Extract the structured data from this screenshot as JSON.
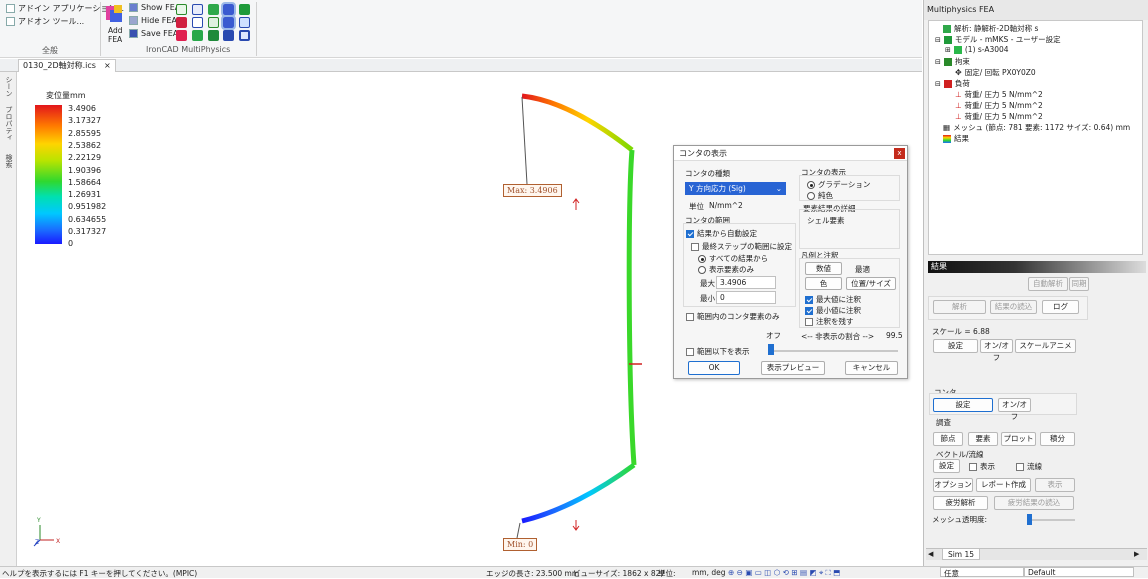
{
  "ribbon": {
    "addin_app": "アドイン アプリケーション...",
    "addin_tools": "アドオン ツール...",
    "general_label": "全般",
    "add_fea_1": "Add",
    "add_fea_2": "FEA",
    "show_fea": "Show FEA",
    "hide_fea": "Hide FEA",
    "save_fea": "Save FEA",
    "group_label": "IronCAD MultiPhysics"
  },
  "document_tab": {
    "label": "0130_2D軸対称.ics",
    "close": "×"
  },
  "left_strip": {
    "scene": "シーン",
    "property": "プロパティ",
    "search": "検索"
  },
  "legend": {
    "title": "変位量mm",
    "values": [
      "3.4906",
      "3.17327",
      "2.85595",
      "2.53862",
      "2.22129",
      "1.90396",
      "1.58664",
      "1.26931",
      "0.951982",
      "0.634655",
      "0.317327",
      "0"
    ]
  },
  "labels": {
    "max": "Max: 3.4906",
    "min": "Min: 0"
  },
  "triad": {
    "y": "Y",
    "z": "Z",
    "x": "X"
  },
  "dialog": {
    "title": "コンタの表示",
    "close": "x",
    "type_label": "コンタの種類",
    "type_value": "Y 方向応力 (Sig)",
    "unit_label": "単位",
    "unit_value": "N/mm^2",
    "range_label": "コンタの範囲",
    "auto_set": "結果から自動設定",
    "last_step": "最終ステップの範囲に設定",
    "all_results": "すべての結果から",
    "shown_only": "表示要素のみ",
    "max_label": "最大",
    "max_value": "3.4906",
    "min_label": "最小",
    "min_value": "0",
    "in_range_only": "範囲内のコンタ要素のみ",
    "display_label": "コンタの表示",
    "gradient": "グラデーション",
    "solid": "純色",
    "elem_detail": "要素結果の詳細",
    "shell": "シェル要素",
    "legend_notes": "凡例と注釈",
    "number": "数値",
    "best": "最適",
    "color": "色",
    "pos_size": "位置/サイズ",
    "max_note": "最大値に注釈",
    "min_note": "最小値に注釈",
    "keep_note": "注釈を残す",
    "show_below": "範囲以下を表示",
    "off": "オフ",
    "hidden_ratio": "<-- 非表示の割合 -->",
    "ratio_value": "99.5",
    "ok": "OK",
    "preview": "表示プレビュー",
    "cancel": "キャンセル"
  },
  "panel": {
    "title": "Multiphysics FEA",
    "tree": {
      "analysis": "解析: 静解析-2D軸対称 s",
      "model": "モデル - mMKS - ユーザー設定",
      "part": "(1)  s-A3004",
      "constraint": "拘束",
      "fixed": "固定/ 回転 PX0Y0Z0",
      "load": "負荷",
      "load1": "荷重/ 圧力 5 N/mm^2",
      "load2": "荷重/ 圧力 5 N/mm^2",
      "load3": "荷重/ 圧力 5 N/mm^2",
      "mesh": "メッシュ (節点: 781   要素: 1172   サイズ: 0.64) mm",
      "results": "結果"
    },
    "results_header": "結果",
    "auto_analysis": "自動解析",
    "sync": "同期",
    "analyze": "解析",
    "read_results": "結果の読込",
    "log": "ログ",
    "scale_label": "スケール = 6.88",
    "settings": "設定",
    "on_off": "オン/オフ",
    "scale_anim": "スケールアニメ",
    "contour_label": "コンタ",
    "contour_settings": "設定",
    "contour_onoff": "オン/オフ",
    "probe_label": "調査",
    "node": "節点",
    "element": "要素",
    "plot": "プロット",
    "integral": "積分",
    "vector_label": "ベクトル/流線",
    "vec_settings": "設定",
    "vec_display": "表示",
    "streamline": "流線",
    "options": "オプション",
    "report": "レポート作成",
    "display": "表示",
    "fatigue": "疲労解析",
    "fatigue_read": "疲労結果の読込",
    "mesh_transparency": "メッシュ透明度:",
    "sim_tab": "Sim 15"
  },
  "status": {
    "help": "ヘルプを表示するには F1 キーを押してください。(MPIC)",
    "edge_length": "エッジの長さ: 23.500 mm",
    "view_size": "ビューサイズ: 1862 x  827",
    "unit": "単位:",
    "unit_value": "mm, deg",
    "mode": "任意",
    "default": "Default"
  },
  "colors": {
    "accent_blue": "#1f6fd0",
    "close_red": "#c42b1c",
    "label_brown": "#a0522d"
  }
}
